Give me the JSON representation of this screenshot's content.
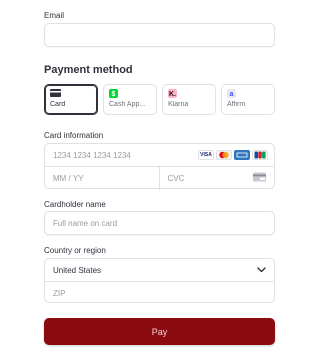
{
  "email": {
    "label": "Email",
    "value": ""
  },
  "payment_method": {
    "title": "Payment method",
    "tabs": [
      {
        "label": "Card",
        "icon": "card-icon",
        "selected": true
      },
      {
        "label": "Cash App...",
        "icon": "cash-app-icon",
        "selected": false
      },
      {
        "label": "Klarna",
        "icon": "klarna-icon",
        "selected": false
      },
      {
        "label": "Affirm",
        "icon": "affirm-icon",
        "selected": false
      }
    ]
  },
  "card_info": {
    "label": "Card information",
    "number_placeholder": "1234 1234 1234 1234",
    "expiry_placeholder": "MM / YY",
    "cvc_placeholder": "CVC",
    "brands": [
      "VISA",
      "mastercard",
      "amex",
      "JCB"
    ]
  },
  "cardholder": {
    "label": "Cardholder name",
    "placeholder": "Full name on card"
  },
  "country": {
    "label": "Country or region",
    "selected": "United States",
    "zip_placeholder": "ZIP"
  },
  "pay_button": {
    "label": "Pay"
  },
  "colors": {
    "pay_button_bg": "#8b0a10",
    "cash_app_green": "#00d632",
    "klarna_pink": "#ffb3c7",
    "border": "#e0e0e6"
  }
}
